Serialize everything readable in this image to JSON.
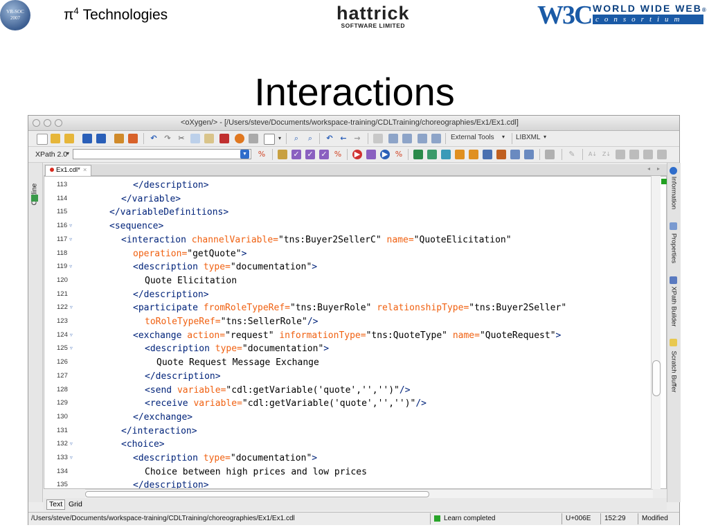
{
  "header": {
    "vrsoc_logo": {
      "line1": "VR-SOC",
      "line2": "2007"
    },
    "company_left": {
      "name_prefix": "π",
      "superscript": "4",
      "name_suffix": " Technologies"
    },
    "company_center": {
      "name": "hattrick",
      "subtitle": "SOFTWARE LIMITED"
    },
    "w3c_logo": {
      "mark": "W3C",
      "line1": "WORLD WIDE WEB",
      "line2": "consortium",
      "reg": "®"
    }
  },
  "slide_title": "Interactions",
  "window": {
    "title": "<oXygen/> - [/Users/steve/Documents/workspace-training/CDLTraining/choreographies/Ex1/Ex1.cdl]",
    "toolbar": {
      "external_tools_label": "External Tools",
      "libxml_label": "LIBXML",
      "xpath_label": "XPath 2.0",
      "xpath_value": ""
    },
    "left_panel_tab": "Outline",
    "editor_tab": "Ex1.cdl*",
    "right_tabs": [
      "Information",
      "Properties",
      "XPath Builder",
      "Scratch Buffer"
    ],
    "mode_tabs": [
      "Text",
      "Grid"
    ],
    "lines": [
      {
        "n": "113",
        "fold": "",
        "tokens": [
          [
            "t",
            "    </description>"
          ]
        ]
      },
      {
        "n": "114",
        "fold": "",
        "tokens": [
          [
            "t",
            "  </variable>"
          ]
        ]
      },
      {
        "n": "115",
        "fold": "",
        "tokens": [
          [
            "t",
            "</variableDefinitions>"
          ]
        ]
      },
      {
        "n": "116",
        "fold": "▿",
        "tokens": [
          [
            "t",
            "<sequence>"
          ]
        ]
      },
      {
        "n": "117",
        "fold": "▿",
        "tokens": [
          [
            "t",
            "  <interaction "
          ],
          [
            "a",
            "channelVariable="
          ],
          [
            "v",
            "\"tns:Buyer2SellerC\" "
          ],
          [
            "a",
            "name="
          ],
          [
            "v",
            "\"QuoteElicitation\""
          ]
        ]
      },
      {
        "n": "118",
        "fold": "",
        "tokens": [
          [
            "a",
            "    operation="
          ],
          [
            "v",
            "\"getQuote\""
          ],
          [
            "t",
            ">"
          ]
        ]
      },
      {
        "n": "119",
        "fold": "▿",
        "tokens": [
          [
            "t",
            "    <description "
          ],
          [
            "a",
            "type="
          ],
          [
            "v",
            "\"documentation\""
          ],
          [
            "t",
            ">"
          ]
        ]
      },
      {
        "n": "120",
        "fold": "",
        "tokens": [
          [
            "v",
            "      Quote Elicitation"
          ]
        ]
      },
      {
        "n": "121",
        "fold": "",
        "tokens": [
          [
            "t",
            "    </description>"
          ]
        ]
      },
      {
        "n": "122",
        "fold": "▿",
        "tokens": [
          [
            "t",
            "    <participate "
          ],
          [
            "a",
            "fromRoleTypeRef="
          ],
          [
            "v",
            "\"tns:BuyerRole\" "
          ],
          [
            "a",
            "relationshipType="
          ],
          [
            "v",
            "\"tns:Buyer2Seller\""
          ]
        ]
      },
      {
        "n": "123",
        "fold": "",
        "tokens": [
          [
            "a",
            "      toRoleTypeRef="
          ],
          [
            "v",
            "\"tns:SellerRole\""
          ],
          [
            "t",
            "/>"
          ]
        ]
      },
      {
        "n": "124",
        "fold": "▿",
        "tokens": [
          [
            "t",
            "    <exchange "
          ],
          [
            "a",
            "action="
          ],
          [
            "v",
            "\"request\" "
          ],
          [
            "a",
            "informationType="
          ],
          [
            "v",
            "\"tns:QuoteType\" "
          ],
          [
            "a",
            "name="
          ],
          [
            "v",
            "\"QuoteRequest\""
          ],
          [
            "t",
            ">"
          ]
        ]
      },
      {
        "n": "125",
        "fold": "▿",
        "tokens": [
          [
            "t",
            "      <description "
          ],
          [
            "a",
            "type="
          ],
          [
            "v",
            "\"documentation\""
          ],
          [
            "t",
            ">"
          ]
        ]
      },
      {
        "n": "126",
        "fold": "",
        "tokens": [
          [
            "v",
            "        Quote Request Message Exchange"
          ]
        ]
      },
      {
        "n": "127",
        "fold": "",
        "tokens": [
          [
            "t",
            "      </description>"
          ]
        ]
      },
      {
        "n": "128",
        "fold": "",
        "tokens": [
          [
            "t",
            "      <send "
          ],
          [
            "a",
            "variable="
          ],
          [
            "v",
            "\"cdl:getVariable('quote','','')\""
          ],
          [
            "t",
            "/>"
          ]
        ]
      },
      {
        "n": "129",
        "fold": "",
        "tokens": [
          [
            "t",
            "      <receive "
          ],
          [
            "a",
            "variable="
          ],
          [
            "v",
            "\"cdl:getVariable('quote','','')\""
          ],
          [
            "t",
            "/>"
          ]
        ]
      },
      {
        "n": "130",
        "fold": "",
        "tokens": [
          [
            "t",
            "    </exchange>"
          ]
        ]
      },
      {
        "n": "131",
        "fold": "",
        "tokens": [
          [
            "t",
            "  </interaction>"
          ]
        ]
      },
      {
        "n": "132",
        "fold": "▿",
        "tokens": [
          [
            "t",
            "  <choice>"
          ]
        ]
      },
      {
        "n": "133",
        "fold": "▿",
        "tokens": [
          [
            "t",
            "    <description "
          ],
          [
            "a",
            "type="
          ],
          [
            "v",
            "\"documentation\""
          ],
          [
            "t",
            ">"
          ]
        ]
      },
      {
        "n": "134",
        "fold": "",
        "tokens": [
          [
            "v",
            "      Choice between high prices and low prices"
          ]
        ]
      },
      {
        "n": "135",
        "fold": "",
        "tokens": [
          [
            "t",
            "    </description>"
          ]
        ]
      }
    ],
    "status": {
      "path": "/Users/steve/Documents/workspace-training/CDLTraining/choreographies/Ex1/Ex1.cdl",
      "message": "Learn completed",
      "unicode": "U+006E",
      "position": "152:29",
      "state": "Modified"
    }
  }
}
